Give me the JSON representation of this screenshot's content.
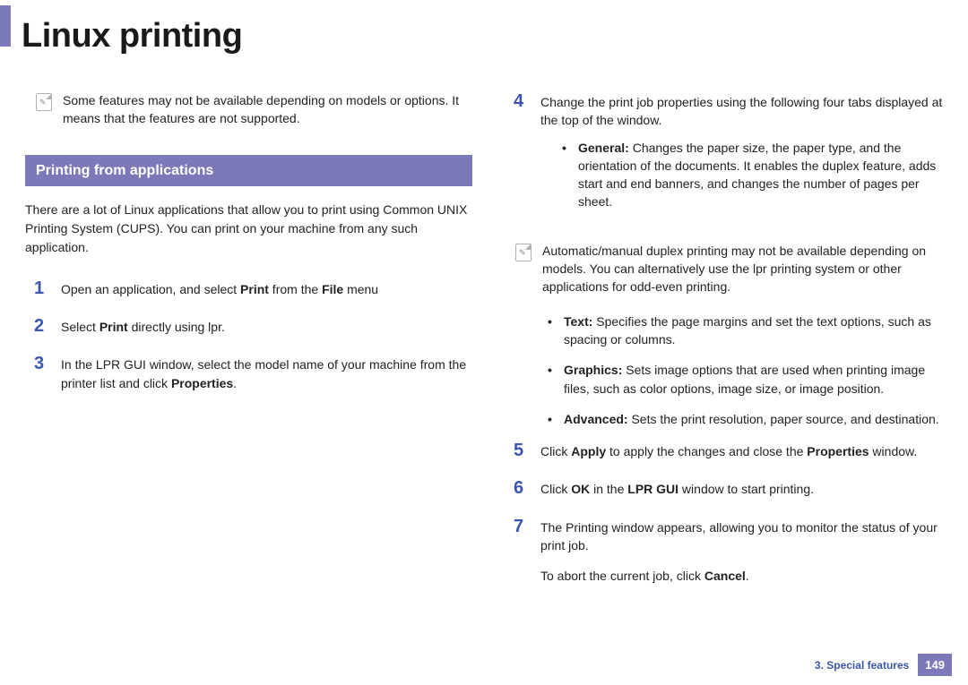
{
  "page_title": "Linux printing",
  "left": {
    "note1": "Some features may not be available depending on models or options. It means that the features are not supported.",
    "section_heading": "Printing from applications",
    "intro": "There are a lot of Linux applications that allow you to print using Common UNIX Printing System (CUPS). You can print on your machine from any such application.",
    "step1_num": "1",
    "step1_a": "Open an application, and select ",
    "step1_b": "Print",
    "step1_c": " from the ",
    "step1_d": "File",
    "step1_e": " menu",
    "step2_num": "2",
    "step2_a": "Select ",
    "step2_b": "Print",
    "step2_c": " directly using lpr.",
    "step3_num": "3",
    "step3_a": "In the LPR GUI window, select the model name of your machine from the printer list and click ",
    "step3_b": "Properties",
    "step3_c": "."
  },
  "right": {
    "step4_num": "4",
    "step4_text": "Change the print job properties using the following four tabs displayed at the top of the window.",
    "b1_label": "General:",
    "b1_text": " Changes the paper size, the paper type, and the orientation of the documents. It enables the duplex feature, adds start and end banners, and changes the number of pages per sheet.",
    "note2": "Automatic/manual duplex printing may not be available depending on models. You can alternatively use the lpr printing system or other applications for odd-even printing.",
    "b2_label": "Text:",
    "b2_text": " Specifies the page margins and set the text options, such as spacing or columns.",
    "b3_label": "Graphics:",
    "b3_text": " Sets image options that are used when printing image files, such as color options, image size, or image position.",
    "b4_label": "Advanced:",
    "b4_text": " Sets the print resolution, paper source, and destination.",
    "step5_num": "5",
    "step5_a": "Click ",
    "step5_b": "Apply",
    "step5_c": " to apply the changes and close the ",
    "step5_d": "Properties",
    "step5_e": " window.",
    "step6_num": "6",
    "step6_a": "Click ",
    "step6_b": "OK",
    "step6_c": " in the ",
    "step6_d": "LPR GUI",
    "step6_e": " window to start printing.",
    "step7_num": "7",
    "step7_text": "The Printing window appears, allowing you to monitor the status of your print job.",
    "step7_extra_a": "To abort the current job, click ",
    "step7_extra_b": "Cancel",
    "step7_extra_c": "."
  },
  "footer": {
    "chapter": "3.  Special features",
    "page": "149"
  }
}
